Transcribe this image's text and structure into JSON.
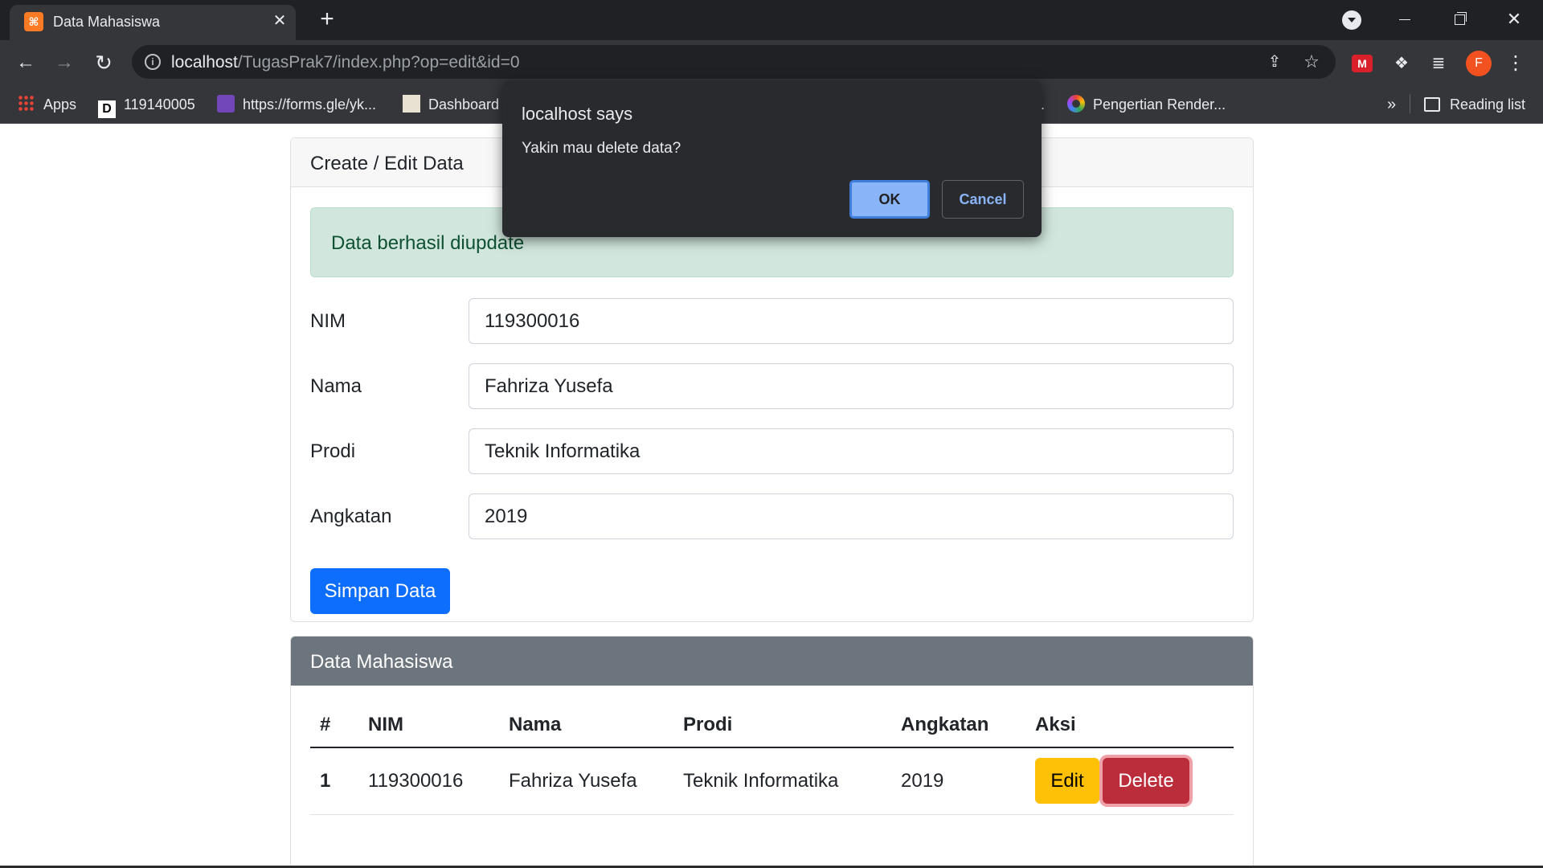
{
  "browser": {
    "tab_title": "Data Mahasiswa",
    "url_host": "localhost",
    "url_path": "/TugasPrak7/index.php?op=edit&id=0",
    "profile_initial": "F",
    "bookmarks": [
      {
        "label": "Apps",
        "icon": "apps-grid-icon"
      },
      {
        "label": "119140005",
        "icon": "dj-icon"
      },
      {
        "label": "https://forms.gle/yk...",
        "icon": "forms-icon"
      },
      {
        "label": "Dashboard",
        "icon": "dashboard-icon"
      },
      {
        "label": ".",
        "icon": ""
      },
      {
        "label": "Pengertian Render...",
        "icon": "render-icon"
      }
    ],
    "bookmarks_more": "»",
    "reading_list": "Reading list"
  },
  "form_card": {
    "header": "Create / Edit Data",
    "alert": "Data berhasil diupdate",
    "fields": [
      {
        "label": "NIM",
        "value": "119300016"
      },
      {
        "label": "Nama",
        "value": "Fahriza Yusefa"
      },
      {
        "label": "Prodi",
        "value": "Teknik Informatika"
      },
      {
        "label": "Angkatan",
        "value": "2019"
      }
    ],
    "submit_label": "Simpan Data"
  },
  "table_card": {
    "header": "Data Mahasiswa",
    "columns": [
      "#",
      "NIM",
      "Nama",
      "Prodi",
      "Angkatan",
      "Aksi"
    ],
    "rows": [
      {
        "no": "1",
        "nim": "119300016",
        "nama": "Fahriza Yusefa",
        "prodi": "Teknik Informatika",
        "angkatan": "2019",
        "edit": "Edit",
        "delete": "Delete"
      }
    ]
  },
  "dialog": {
    "title": "localhost says",
    "message": "Yakin mau delete data?",
    "ok": "OK",
    "cancel": "Cancel"
  },
  "colors": {
    "primary": "#0d6efd",
    "warning": "#ffc107",
    "danger": "#bb2d3b",
    "success_bg": "#d1e7dd",
    "secondary": "#6c757d"
  }
}
